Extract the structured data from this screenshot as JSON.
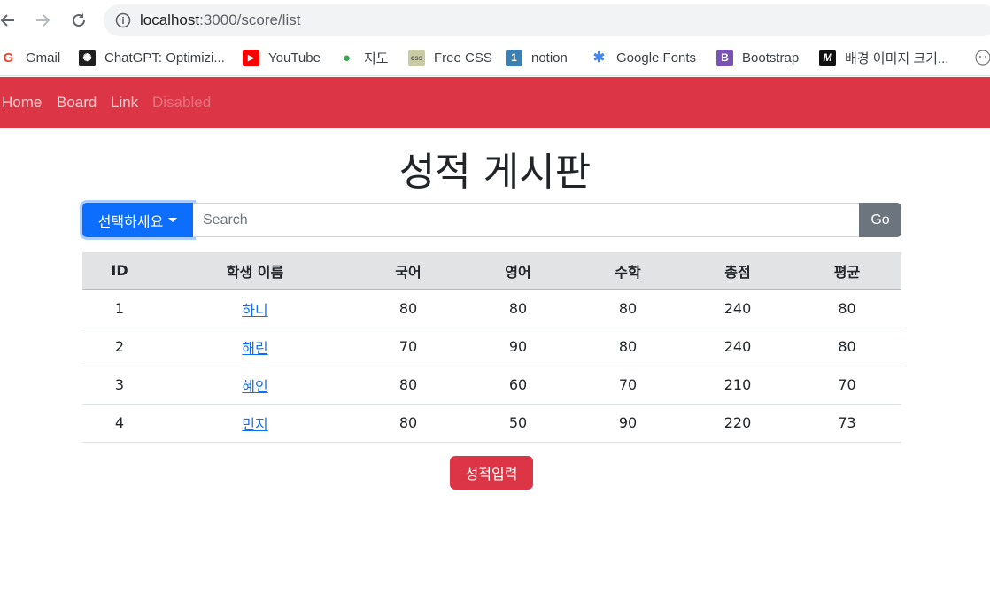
{
  "browser": {
    "url_host": "localhost",
    "url_path": ":3000/score/list"
  },
  "bookmarks": [
    {
      "label": "Gmail",
      "icon": "gmail-icon",
      "glyph": "G",
      "color": "#ea4335"
    },
    {
      "label": "ChatGPT: Optimizi...",
      "icon": "chatgpt-icon",
      "glyph": "✺",
      "color": "#1f1f1f"
    },
    {
      "label": "YouTube",
      "icon": "youtube-icon",
      "glyph": "▶",
      "color": "#ff0000"
    },
    {
      "label": "지도",
      "icon": "maps-pin-icon",
      "glyph": "●",
      "color": "#34a853"
    },
    {
      "label": "Free CSS",
      "icon": "freecss-icon",
      "glyph": "css",
      "color": "#b5b88e"
    },
    {
      "label": "notion",
      "icon": "notion-icon",
      "glyph": "1",
      "color": "#3c7fb1"
    },
    {
      "label": "Google Fonts",
      "icon": "google-fonts-icon",
      "glyph": "✱",
      "color": "#4285f4"
    },
    {
      "label": "Bootstrap",
      "icon": "bootstrap-icon",
      "glyph": "B",
      "color": "#7952b3"
    },
    {
      "label": "배경 이미지 크기...",
      "icon": "medium-icon",
      "glyph": "M",
      "color": "#111111"
    }
  ],
  "navbar": {
    "links": [
      {
        "label": "Home"
      },
      {
        "label": "Board"
      },
      {
        "label": "Link"
      },
      {
        "label": "Disabled"
      }
    ]
  },
  "page": {
    "title": "성적 게시판"
  },
  "search": {
    "dropdown_label": "선택하세요",
    "placeholder": "Search",
    "value": "",
    "go_label": "Go"
  },
  "table": {
    "headers": [
      "ID",
      "학생 이름",
      "국어",
      "영어",
      "수학",
      "총점",
      "평균"
    ],
    "rows": [
      {
        "id": "1",
        "name": "하니",
        "korean": "80",
        "english": "80",
        "math": "80",
        "total": "240",
        "avg": "80"
      },
      {
        "id": "2",
        "name": "해린",
        "korean": "70",
        "english": "90",
        "math": "80",
        "total": "240",
        "avg": "80"
      },
      {
        "id": "3",
        "name": "혜인",
        "korean": "80",
        "english": "60",
        "math": "70",
        "total": "210",
        "avg": "70"
      },
      {
        "id": "4",
        "name": "민지",
        "korean": "80",
        "english": "50",
        "math": "90",
        "total": "220",
        "avg": "73"
      }
    ]
  },
  "actions": {
    "submit_label": "성적입력"
  },
  "colors": {
    "navbar": "#dc3545",
    "primary": "#0d6efd",
    "secondary": "#6c757d",
    "table_head": "#e2e3e5"
  }
}
